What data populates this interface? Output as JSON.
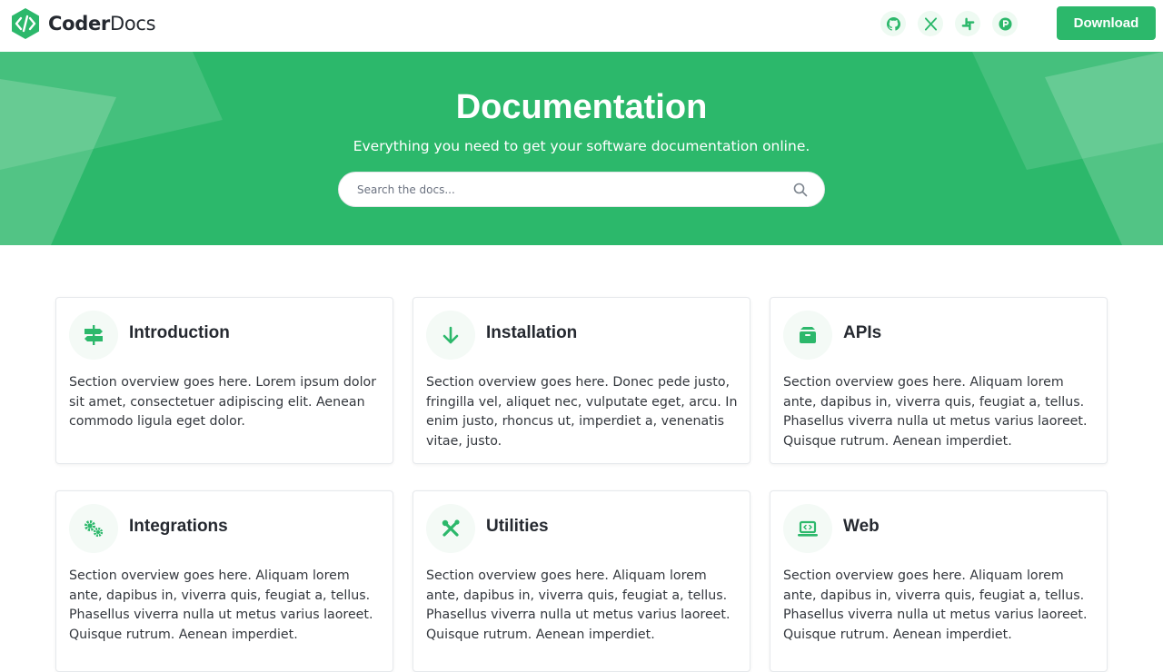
{
  "brand": {
    "name_bold": "Coder",
    "name_light": "Docs"
  },
  "header": {
    "social": [
      "github-icon",
      "x-twitter-icon",
      "slack-icon",
      "product-hunt-icon"
    ],
    "download_label": "Download"
  },
  "hero": {
    "title": "Documentation",
    "subtitle": "Everything you need to get your software documentation online.",
    "search_placeholder": "Search the docs..."
  },
  "colors": {
    "accent": "#2cb86b",
    "icon_bg": "#f4faf6"
  },
  "cards": [
    {
      "icon": "signs-post-icon",
      "title": "Introduction",
      "text": "Section overview goes here. Lorem ipsum dolor sit amet, consectetuer adipiscing elit. Aenean commodo ligula eget dolor."
    },
    {
      "icon": "arrow-down-icon",
      "title": "Installation",
      "text": "Section overview goes here. Donec pede justo, fringilla vel, aliquet nec, vulputate eget, arcu. In enim justo, rhoncus ut, imperdiet a, venenatis vitae, justo."
    },
    {
      "icon": "box-icon",
      "title": "APIs",
      "text": "Section overview goes here. Aliquam lorem ante, dapibus in, viverra quis, feugiat a, tellus. Phasellus viverra nulla ut metus varius laoreet. Quisque rutrum. Aenean imperdiet."
    },
    {
      "icon": "cogs-icon",
      "title": "Integrations",
      "text": "Section overview goes here. Aliquam lorem ante, dapibus in, viverra quis, feugiat a, tellus. Phasellus viverra nulla ut metus varius laoreet. Quisque rutrum. Aenean imperdiet."
    },
    {
      "icon": "tools-icon",
      "title": "Utilities",
      "text": "Section overview goes here. Aliquam lorem ante, dapibus in, viverra quis, feugiat a, tellus. Phasellus viverra nulla ut metus varius laoreet. Quisque rutrum. Aenean imperdiet."
    },
    {
      "icon": "laptop-code-icon",
      "title": "Web",
      "text": "Section overview goes here. Aliquam lorem ante, dapibus in, viverra quis, feugiat a, tellus. Phasellus viverra nulla ut metus varius laoreet. Quisque rutrum. Aenean imperdiet."
    }
  ]
}
